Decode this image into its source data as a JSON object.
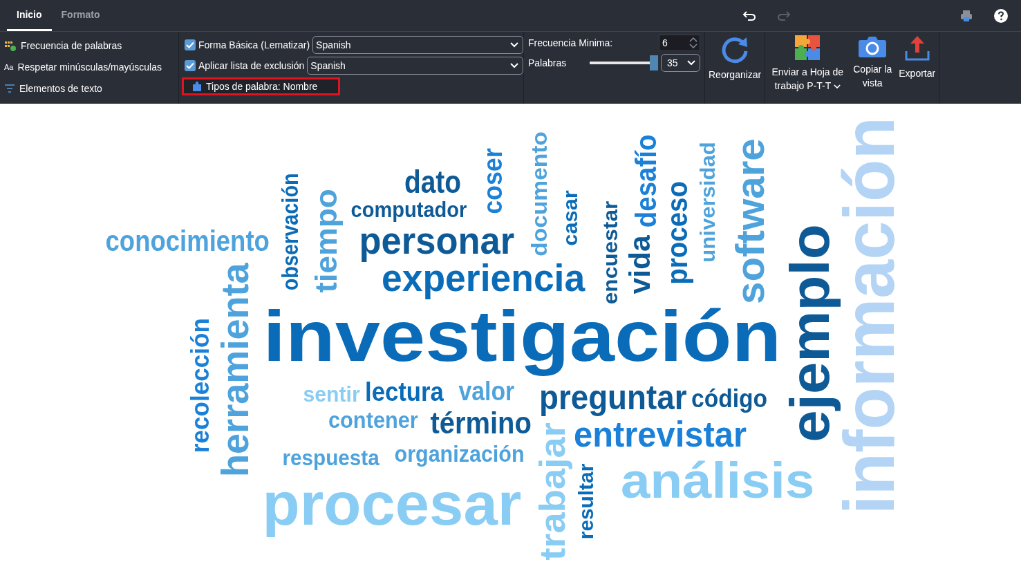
{
  "tabs": [
    {
      "label": "Inicio",
      "selected": true
    },
    {
      "label": "Formato",
      "selected": false
    }
  ],
  "history": {
    "undo": {
      "disabled": false
    },
    "redo": {
      "disabled": true
    }
  },
  "options": [
    {
      "label": "Frecuencia de palabras"
    },
    {
      "label": "Respetar minúsculas/mayúsculas",
      "icon": "Aa"
    },
    {
      "label": "Elementos de texto"
    }
  ],
  "language_options": [
    {
      "label": "Forma Básica (Lematizar)",
      "checked": true,
      "language": "Spanish"
    },
    {
      "label": "Aplicar lista de exclusión",
      "checked": true,
      "language": "Spanish"
    }
  ],
  "word_types": {
    "label": "Tipos de palabra: Nombre",
    "highlighted": true
  },
  "min_frequency": {
    "label": "Frecuencia Minima:",
    "value": "6"
  },
  "word_count": {
    "label": "Palabras",
    "level": 1.0,
    "value": "35"
  },
  "actions": [
    {
      "label": "Reorganizar",
      "dropdown": false
    },
    {
      "label": "Enviar a Hoja de trabajo P-T-T",
      "dropdown": true
    },
    {
      "label": "Copiar la vista",
      "dropdown": false
    },
    {
      "label": "Exportar",
      "dropdown": false
    }
  ],
  "words": [
    {
      "text": "conocimiento",
      "color": "#4ea3dc",
      "kind": "horizontal"
    },
    {
      "text": "observación",
      "color": "#0a6cb8",
      "kind": "vertical"
    },
    {
      "text": "tiempo",
      "color": "#4ea3dc",
      "kind": "vertical"
    },
    {
      "text": "dato",
      "color": "#0e5a96",
      "kind": "horizontal"
    },
    {
      "text": "computador",
      "color": "#0e5a96",
      "kind": "horizontal"
    },
    {
      "text": "personar",
      "color": "#0e5a96",
      "kind": "horizontal"
    },
    {
      "text": "coser",
      "color": "#1a80d8",
      "kind": "vertical"
    },
    {
      "text": "documento",
      "color": "#4ea3dc",
      "kind": "vertical"
    },
    {
      "text": "casar",
      "color": "#0a6cb8",
      "kind": "vertical"
    },
    {
      "text": "experiencia",
      "color": "#0a6cb8",
      "kind": "horizontal"
    },
    {
      "text": "encuestar",
      "color": "#0e5a96",
      "kind": "vertical"
    },
    {
      "text": "vida",
      "color": "#0e5a96",
      "kind": "vertical"
    },
    {
      "text": "desafío",
      "color": "#1a80d8",
      "kind": "vertical"
    },
    {
      "text": "proceso",
      "color": "#0a6cb8",
      "kind": "vertical"
    },
    {
      "text": "universidad",
      "color": "#4ea3dc",
      "kind": "vertical"
    },
    {
      "text": "software",
      "color": "#4ea3dc",
      "kind": "vertical"
    },
    {
      "text": "ejemplo",
      "color": "#0e5a96",
      "kind": "vertical"
    },
    {
      "text": "información",
      "color": "#b3d4f5",
      "kind": "vertical"
    },
    {
      "text": "herramienta",
      "color": "#4ea3dc",
      "kind": "vertical"
    },
    {
      "text": "recolección",
      "color": "#1a80d8",
      "kind": "vertical"
    },
    {
      "text": "investigación",
      "color": "#0a6cb8",
      "kind": "horizontal"
    },
    {
      "text": "sentir",
      "color": "#8acdf4",
      "kind": "horizontal"
    },
    {
      "text": "lectura",
      "color": "#0a6cb8",
      "kind": "horizontal"
    },
    {
      "text": "valor",
      "color": "#4ea3dc",
      "kind": "horizontal"
    },
    {
      "text": "preguntar",
      "color": "#0e5a96",
      "kind": "horizontal"
    },
    {
      "text": "código",
      "color": "#0e5a96",
      "kind": "horizontal"
    },
    {
      "text": "contener",
      "color": "#4ea3dc",
      "kind": "horizontal"
    },
    {
      "text": "término",
      "color": "#0e5a96",
      "kind": "horizontal"
    },
    {
      "text": "entrevistar",
      "color": "#1a80d8",
      "kind": "horizontal"
    },
    {
      "text": "respuesta",
      "color": "#4ea3dc",
      "kind": "horizontal"
    },
    {
      "text": "organización",
      "color": "#4ea3dc",
      "kind": "horizontal"
    },
    {
      "text": "trabajar",
      "color": "#8acdf4",
      "kind": "vertical"
    },
    {
      "text": "resultar",
      "color": "#0a6cb8",
      "kind": "vertical"
    },
    {
      "text": "análisis",
      "color": "#8acdf4",
      "kind": "horizontal"
    },
    {
      "text": "procesar",
      "color": "#8acdf4",
      "kind": "horizontal"
    }
  ]
}
